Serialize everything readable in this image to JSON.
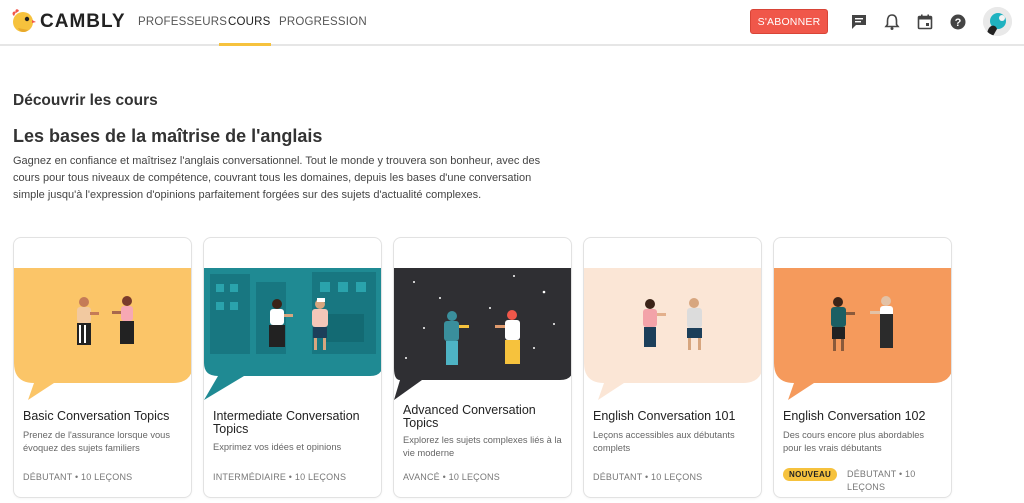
{
  "header": {
    "brand": "CAMBLY",
    "nav": [
      {
        "label": "PROFESSEURS"
      },
      {
        "label": "COURS"
      },
      {
        "label": "PROGRESSION"
      }
    ],
    "subscribe_label": "S'ABONNER",
    "icons": [
      "chat-icon",
      "bell-icon",
      "calendar-icon",
      "help-icon"
    ],
    "accent_color": "#f6c23d",
    "cta_color": "#f0574a"
  },
  "main": {
    "discover_title": "Découvrir les cours",
    "section_title": "Les bases de la maîtrise de l'anglais",
    "section_desc": "Gagnez en confiance et maîtrisez l'anglais conversationnel. Tout le monde y trouvera son bonheur, avec des cours pour tous niveaux de compétence, couvrant tous les domaines, depuis les bases d'une conversation simple jusqu'à l'expression d'opinions parfaitement forgées sur des sujets d'actualité complexes."
  },
  "cards": [
    {
      "title": "Basic Conversation Topics",
      "desc": "Prenez de l'assurance lorsque vous évoquez des sujets familiers",
      "meta": "DÉBUTANT • 10 LEÇONS",
      "bg": "#fbc568"
    },
    {
      "title": "Intermediate Conversation Topics",
      "desc": "Exprimez vos idées et opinions",
      "meta": "INTERMÉDIAIRE • 10 LEÇONS",
      "bg": "#1f8a93"
    },
    {
      "title": "Advanced Conversation Topics",
      "desc": "Explorez les sujets complexes liés à la vie moderne",
      "meta": "AVANCÉ • 10 LEÇONS",
      "bg": "#2f2f33"
    },
    {
      "title": "English Conversation 101",
      "desc": "Leçons accessibles aux débutants complets",
      "meta": "DÉBUTANT • 10 LEÇONS",
      "bg": "#fbe6d6"
    },
    {
      "title": "English Conversation 102",
      "desc": "Des cours encore plus abordables pour les vrais débutants",
      "badge": "NOUVEAU",
      "meta": "DÉBUTANT • 10 LEÇONS",
      "bg": "#f59a5c"
    }
  ]
}
